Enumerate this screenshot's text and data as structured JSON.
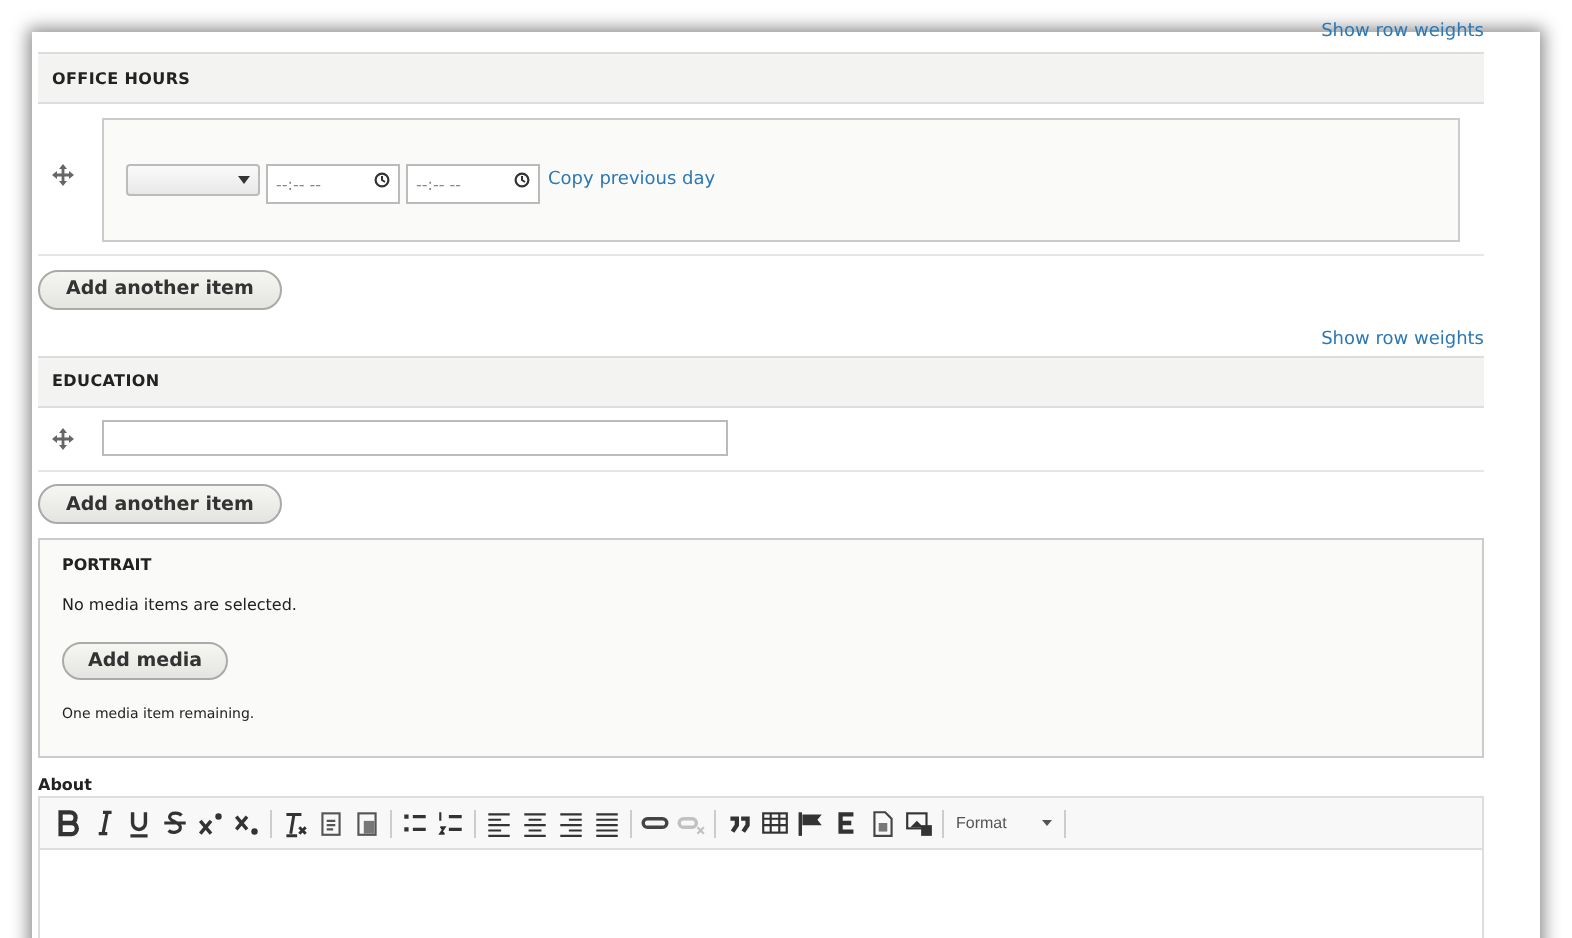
{
  "top_link": "Show row weights",
  "office_hours": {
    "title": "OFFICE HOURS",
    "rows": [
      {
        "day": "",
        "start": {
          "placeholder": "--:-- --"
        },
        "end": {
          "placeholder": "--:-- --"
        },
        "copy_link": "Copy previous day"
      }
    ],
    "add_button": "Add another item",
    "weights_link": "Show row weights"
  },
  "education": {
    "title": "EDUCATION",
    "rows": [
      {
        "value": ""
      }
    ],
    "add_button": "Add another item"
  },
  "portrait": {
    "title": "PORTRAIT",
    "status": "No media items are selected.",
    "add_button": "Add media",
    "remaining": "One media item remaining."
  },
  "about": {
    "label": "About",
    "toolbar": [
      [
        {
          "kind": "bold",
          "disabled": false
        },
        {
          "kind": "italic",
          "disabled": false
        },
        {
          "kind": "underline",
          "disabled": false
        },
        {
          "kind": "strike",
          "disabled": false
        },
        {
          "kind": "superscript",
          "disabled": false
        },
        {
          "kind": "subscript",
          "disabled": false
        }
      ],
      [
        {
          "kind": "clear-format",
          "disabled": false
        },
        {
          "kind": "paste-text",
          "disabled": false
        },
        {
          "kind": "paste-word",
          "disabled": false
        }
      ],
      [
        {
          "kind": "bullet-list",
          "disabled": false
        },
        {
          "kind": "number-list",
          "disabled": false
        }
      ],
      [
        {
          "kind": "align-left",
          "disabled": false
        },
        {
          "kind": "align-center",
          "disabled": false
        },
        {
          "kind": "align-right",
          "disabled": false
        },
        {
          "kind": "justify",
          "disabled": false
        }
      ],
      [
        {
          "kind": "link",
          "disabled": false
        },
        {
          "kind": "unlink",
          "disabled": true
        }
      ],
      [
        {
          "kind": "quote",
          "disabled": false
        },
        {
          "kind": "table",
          "disabled": false
        },
        {
          "kind": "anchor",
          "disabled": false
        },
        {
          "kind": "entity",
          "disabled": false
        },
        {
          "kind": "document",
          "disabled": false
        },
        {
          "kind": "image",
          "disabled": false
        }
      ]
    ],
    "format": "Format"
  }
}
